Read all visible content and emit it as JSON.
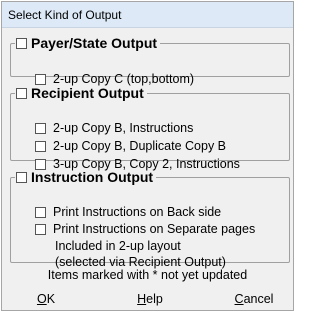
{
  "window": {
    "title": "Select Kind of Output"
  },
  "groups": [
    {
      "label": "Payer/State Output",
      "options": [
        "2-up Copy C (top,bottom)"
      ]
    },
    {
      "label": "Recipient Output",
      "options": [
        "2-up Copy B, Instructions",
        "2-up Copy B, Duplicate Copy B",
        "3-up Copy B, Copy 2, Instructions"
      ]
    },
    {
      "label": "Instruction Output",
      "options": [
        "Print Instructions on Back side",
        "Print Instructions on Separate pages"
      ],
      "notes": [
        "Included in 2-up layout",
        "(selected via Recipient Output)"
      ]
    }
  ],
  "footer_note": "Items marked with * not yet updated",
  "buttons": {
    "ok": {
      "mnemonic": "O",
      "rest": "K"
    },
    "help": {
      "mnemonic": "H",
      "rest": "elp"
    },
    "cancel": {
      "mnemonic": "C",
      "rest": "ancel"
    }
  }
}
